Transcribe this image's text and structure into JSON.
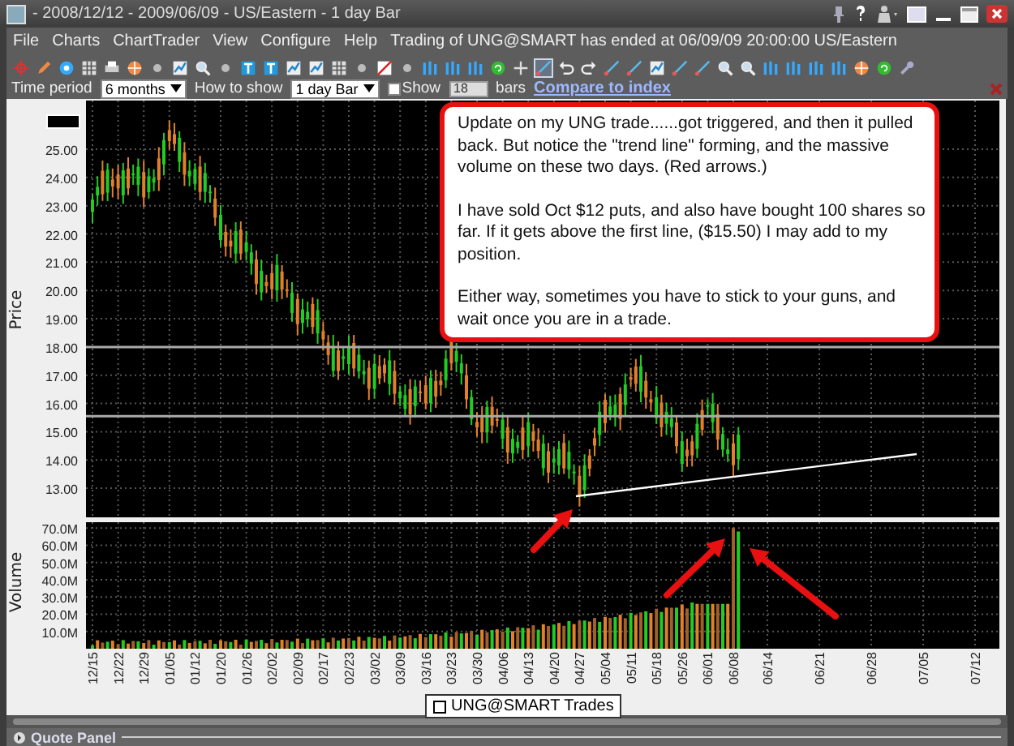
{
  "window": {
    "title": "- 2008/12/12 - 2009/06/09 - US/Eastern - 1 day Bar"
  },
  "menu": [
    {
      "label": "File"
    },
    {
      "label": "Charts"
    },
    {
      "label": "ChartTrader"
    },
    {
      "label": "View"
    },
    {
      "label": "Configure"
    },
    {
      "label": "Help"
    }
  ],
  "status": "Trading of UNG@SMART has ended at 06/09/09 20:00:00 US/Eastern",
  "toolbar": [
    {
      "kind": "crosshair",
      "selected": false
    },
    {
      "kind": "pencil",
      "selected": false
    },
    {
      "kind": "circle",
      "selected": false
    },
    {
      "kind": "grid",
      "selected": false
    },
    {
      "kind": "printer",
      "selected": false
    },
    {
      "kind": "globe",
      "selected": false
    },
    {
      "kind": "dot",
      "selected": false
    },
    {
      "kind": "chart",
      "selected": false
    },
    {
      "kind": "zoom",
      "selected": false
    },
    {
      "kind": "dot",
      "selected": false
    },
    {
      "kind": "text",
      "selected": false
    },
    {
      "kind": "text",
      "selected": false
    },
    {
      "kind": "chart",
      "selected": false
    },
    {
      "kind": "chart",
      "selected": false
    },
    {
      "kind": "grid",
      "selected": false
    },
    {
      "kind": "dot",
      "selected": false
    },
    {
      "kind": "slash",
      "selected": false
    },
    {
      "kind": "dot",
      "selected": false
    },
    {
      "kind": "bars",
      "selected": false
    },
    {
      "kind": "bars",
      "selected": false
    },
    {
      "kind": "bars",
      "selected": false
    },
    {
      "kind": "refresh",
      "selected": false
    },
    {
      "kind": "plus",
      "selected": false
    },
    {
      "kind": "line",
      "selected": true
    },
    {
      "kind": "undo",
      "selected": false
    },
    {
      "kind": "redo",
      "selected": false
    },
    {
      "kind": "line",
      "selected": false
    },
    {
      "kind": "line",
      "selected": false
    },
    {
      "kind": "chart",
      "selected": false
    },
    {
      "kind": "line",
      "selected": false
    },
    {
      "kind": "line",
      "selected": false
    },
    {
      "kind": "zoom",
      "selected": false
    },
    {
      "kind": "zoom",
      "selected": false
    },
    {
      "kind": "bars",
      "selected": false
    },
    {
      "kind": "bars",
      "selected": false
    },
    {
      "kind": "bars",
      "selected": false
    },
    {
      "kind": "bars",
      "selected": false
    },
    {
      "kind": "globe",
      "selected": false
    },
    {
      "kind": "refresh",
      "selected": false
    },
    {
      "kind": "wrench",
      "selected": false
    }
  ],
  "options": {
    "time_period": {
      "label": "Time period",
      "value": "6 months"
    },
    "how_to_show": {
      "label": "How to show",
      "value": "1 day Bar"
    },
    "show": {
      "label": "Show",
      "checked": false,
      "value": "18",
      "disabled": true,
      "unit": "bars"
    },
    "compare_link": "Compare to index"
  },
  "price_panel": {
    "axis_title": "Price",
    "yticks": [
      "25.00",
      "24.00",
      "23.00",
      "22.00",
      "21.00",
      "20.00",
      "19.00",
      "18.00",
      "17.00",
      "16.00",
      "15.00",
      "14.00",
      "13.00"
    ]
  },
  "volume_panel": {
    "axis_title": "Volume",
    "yticks": [
      "70.0M",
      "60.0M",
      "50.0M",
      "40.0M",
      "30.0M",
      "20.0M",
      "10.0M"
    ]
  },
  "dates": [
    "12/15",
    "12/22",
    "12/29",
    "01/05",
    "01/12",
    "01/20",
    "01/26",
    "02/02",
    "02/09",
    "02/17",
    "02/23",
    "03/02",
    "03/09",
    "03/16",
    "03/23",
    "03/30",
    "04/06",
    "04/13",
    "04/20",
    "04/27",
    "05/04",
    "05/11",
    "05/18",
    "05/26",
    "06/01",
    "06/08",
    "06/14",
    "06/21",
    "06/28",
    "07/05",
    "07/12"
  ],
  "legend": {
    "label": "UNG@SMART Trades",
    "checked": false
  },
  "note": {
    "paragraphs": [
      "Update on my UNG trade......got triggered, and then it pulled back. But notice the \"trend line\" forming, and the massive volume on these two days. (Red arrows.)",
      "I have sold Oct $12 puts, and also have bought 100 shares so far. If it gets above the first line, ($15.50) I may add to my position.",
      "Either way, sometimes you have to stick to your guns, and wait once you are in a trade."
    ]
  },
  "quote_panel": {
    "title": "Quote Panel"
  }
}
